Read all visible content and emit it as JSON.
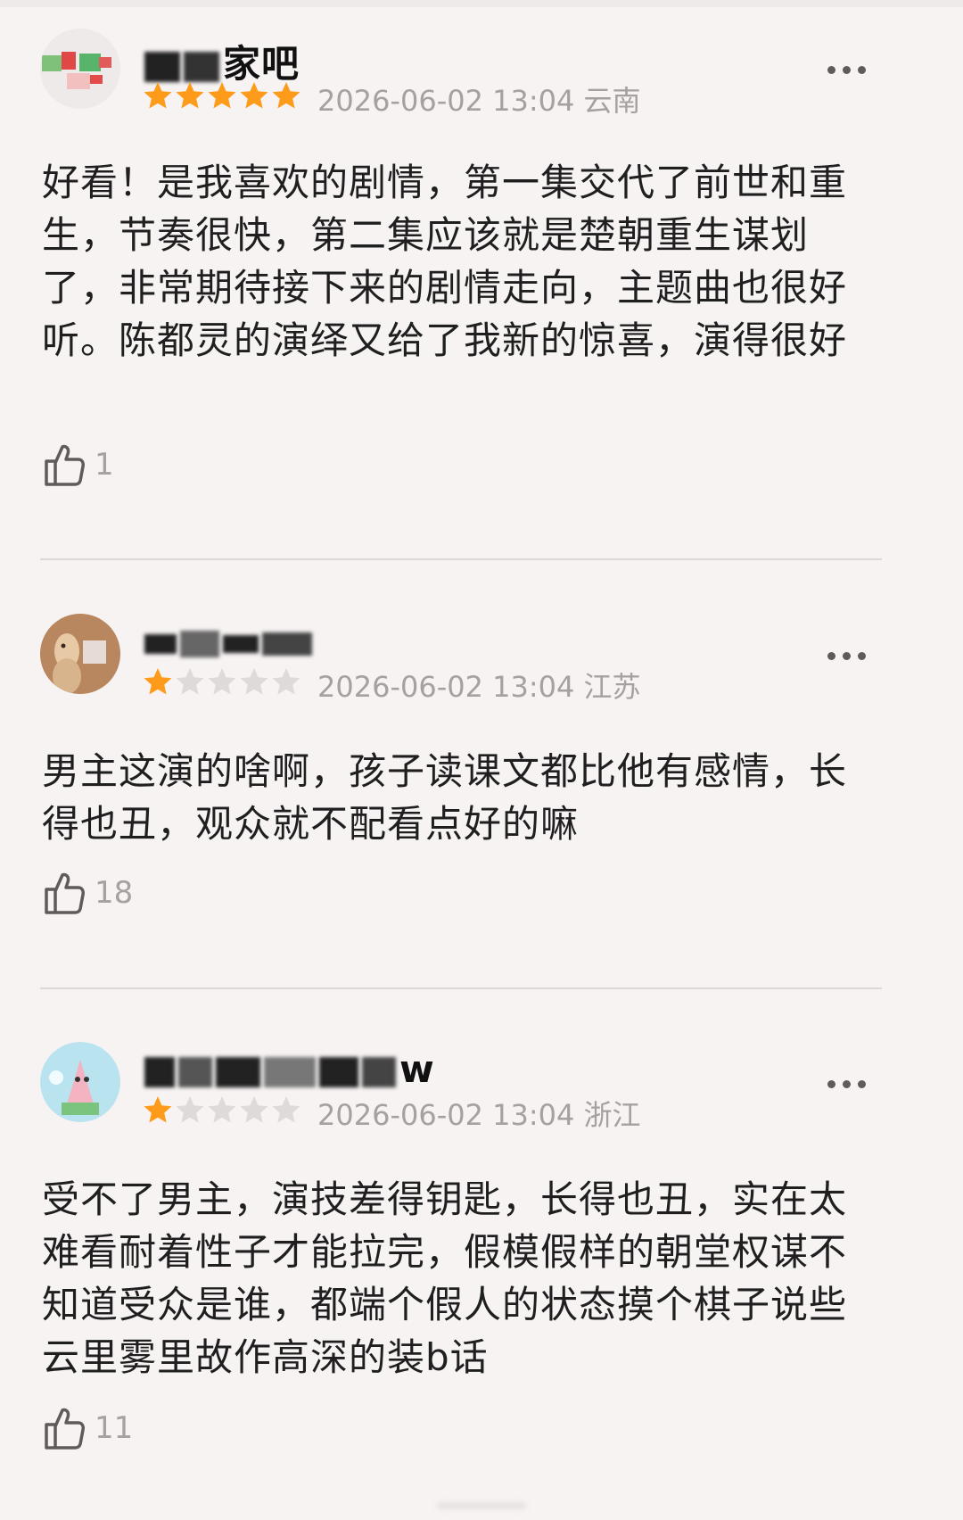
{
  "reviews": [
    {
      "username": "家吧",
      "rating": 5,
      "datetime": "2026-06-02 13:04",
      "location": "云南",
      "content": "好看！是我喜欢的剧情，第一集交代了前世和重生，节奏很快，第二集应该就是楚朝重生谋划了，非常期待接下来的剧情走向，主题曲也很好听。陈都灵的演绎又给了我新的惊喜，演得很好",
      "likes": "1"
    },
    {
      "username": "",
      "rating": 1,
      "datetime": "2026-06-02 13:04",
      "location": "江苏",
      "content": "男主这演的啥啊，孩子读课文都比他有感情，长得也丑，观众就不配看点好的嘛",
      "likes": "18"
    },
    {
      "username": "w",
      "rating": 1,
      "datetime": "2026-06-02 13:04",
      "location": "浙江",
      "content": "受不了男主，演技差得钥匙，长得也丑，实在太难看耐着性子才能拉完，假模假样的朝堂权谋不知道受众是谁，都端个假人的状态摸个棋子说些云里雾里故作高深的装b话",
      "likes": "11"
    }
  ],
  "colors": {
    "star_filled": "#ff9b1a",
    "star_empty": "#dedada",
    "meta_text": "#a5a1a1",
    "background": "#f7f3f3"
  },
  "icons": {
    "more": "more-dots-icon",
    "like": "thumbs-up-icon",
    "star": "star-icon"
  }
}
